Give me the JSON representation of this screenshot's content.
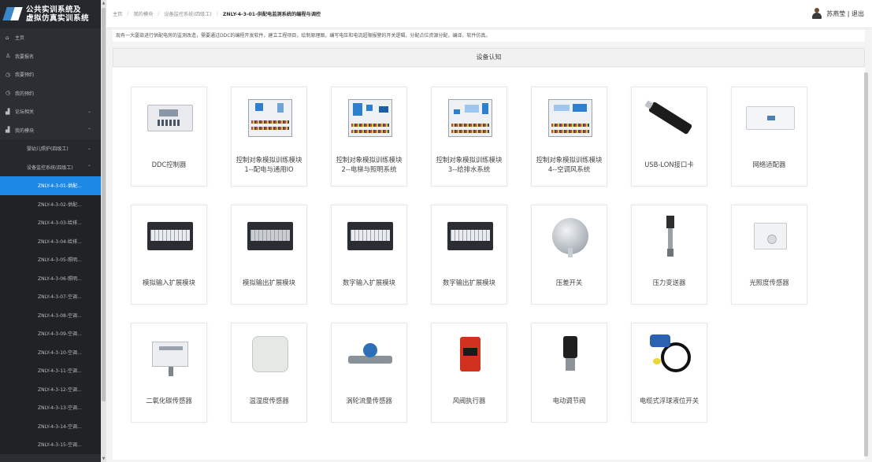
{
  "app": {
    "title_line1": "公共实训系统及",
    "title_line2": "虚拟仿真实训系统"
  },
  "sidebar": {
    "items": [
      {
        "label": "主页",
        "icon": "home-icon"
      },
      {
        "label": "我要报名",
        "icon": "user-icon"
      },
      {
        "label": "我要预约",
        "icon": "clock-icon"
      },
      {
        "label": "我的预约",
        "icon": "clock-icon"
      },
      {
        "label": "论坛相关",
        "icon": "chart-icon"
      },
      {
        "label": "我的模块",
        "icon": "chart-icon"
      }
    ],
    "submodules": [
      {
        "label": "婴幼儿照护(四级工)"
      },
      {
        "label": "设备监控系统(四级工)"
      }
    ],
    "tasks": [
      {
        "label": "ZNLY-4-3-01-供配..."
      },
      {
        "label": "ZNLY-4-3-02-供配..."
      },
      {
        "label": "ZNLY-4-3-03-给排..."
      },
      {
        "label": "ZNLY-4-3-04-给排..."
      },
      {
        "label": "ZNLY-4-3-05-照明..."
      },
      {
        "label": "ZNLY-4-3-06-照明..."
      },
      {
        "label": "ZNLY-4-3-07-空调..."
      },
      {
        "label": "ZNLY-4-3-08-空调..."
      },
      {
        "label": "ZNLY-4-3-09-空调..."
      },
      {
        "label": "ZNLY-4-3-10-空调..."
      },
      {
        "label": "ZNLY-4-3-11-空调..."
      },
      {
        "label": "ZNLY-4-3-12-空调..."
      },
      {
        "label": "ZNLY-4-3-13-空调..."
      },
      {
        "label": "ZNLY-4-3-14-空调..."
      },
      {
        "label": "ZNLY-4-3-15-空调..."
      }
    ]
  },
  "breadcrumb": {
    "items": [
      "主页",
      "我的模块",
      "设备监控系统(四级工)"
    ],
    "current": "ZNLY-4-3-01-供配电监测系统的编程与调控"
  },
  "user": {
    "name_logout": "苏燕莹 | 退出"
  },
  "content": {
    "description": "现有一大厦欲进行供配电房的监测改造，需要通过DDC的编程开发软件，建立工程项目，绘制原理图，编写电压和电流超限报警的开关逻辑，分配点位资源分配，编译，软件仿真。",
    "section_title": "设备认知",
    "devices": [
      {
        "name": "DDC控制器"
      },
      {
        "name": "控制对象模拟训练模块1--配电与通用IO"
      },
      {
        "name": "控制对象模拟训练模块2--电梯与照明系统"
      },
      {
        "name": "控制对象模拟训练模块3--给排水系统"
      },
      {
        "name": "控制对象模拟训练模块4--空调风系统"
      },
      {
        "name": "USB-LON接口卡"
      },
      {
        "name": "网络适配器"
      },
      {
        "name": "模拟输入扩展模块"
      },
      {
        "name": "模拟输出扩展模块"
      },
      {
        "name": "数字输入扩展模块"
      },
      {
        "name": "数字输出扩展模块"
      },
      {
        "name": "压差开关"
      },
      {
        "name": "压力变送器"
      },
      {
        "name": "光照度传感器"
      },
      {
        "name": "二氧化碳传感器"
      },
      {
        "name": "温湿度传感器"
      },
      {
        "name": "涡轮流量传感器"
      },
      {
        "name": "风阀执行器"
      },
      {
        "name": "电动调节阀"
      },
      {
        "name": "电缆式浮球液位开关"
      }
    ]
  },
  "colors": {
    "sidebar_bg": "#2b2f33",
    "active_bg": "#1e88e5"
  }
}
